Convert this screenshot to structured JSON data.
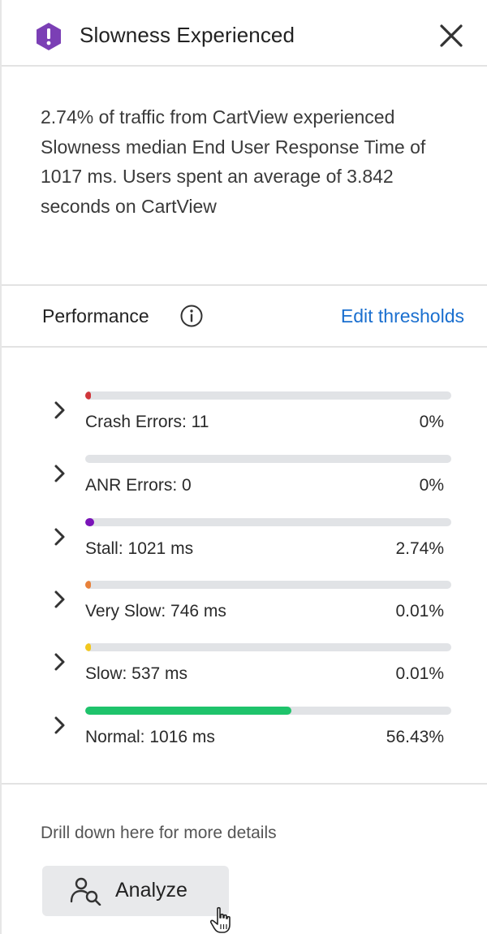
{
  "header": {
    "title": "Slowness Experienced",
    "alert_color": "#7b3fb5"
  },
  "summary": {
    "text": "2.74% of traffic from CartView experienced Slowness median End User Response Time of 1017 ms. Users spent an average of 3.842 seconds on CartView"
  },
  "performance": {
    "title": "Performance",
    "edit_label": "Edit thresholds"
  },
  "metrics": [
    {
      "label": "Crash Errors: 11",
      "pct": "0%",
      "fill_fraction": 0.015,
      "color": "#d0363b"
    },
    {
      "label": "ANR Errors: 0",
      "pct": "0%",
      "fill_fraction": 0,
      "color": "#d0d0d0"
    },
    {
      "label": "Stall: 1021 ms",
      "pct": "2.74%",
      "fill_fraction": 0.025,
      "color": "#7a14b8"
    },
    {
      "label": "Very Slow: 746 ms",
      "pct": "0.01%",
      "fill_fraction": 0.015,
      "color": "#e8813a"
    },
    {
      "label": "Slow: 537 ms",
      "pct": "0.01%",
      "fill_fraction": 0.015,
      "color": "#f2c71d"
    },
    {
      "label": "Normal: 1016 ms",
      "pct": "56.43%",
      "fill_fraction": 0.564,
      "color": "#1ec36b"
    }
  ],
  "footer": {
    "drill_text": "Drill down here for more details",
    "analyze_label": "Analyze"
  }
}
